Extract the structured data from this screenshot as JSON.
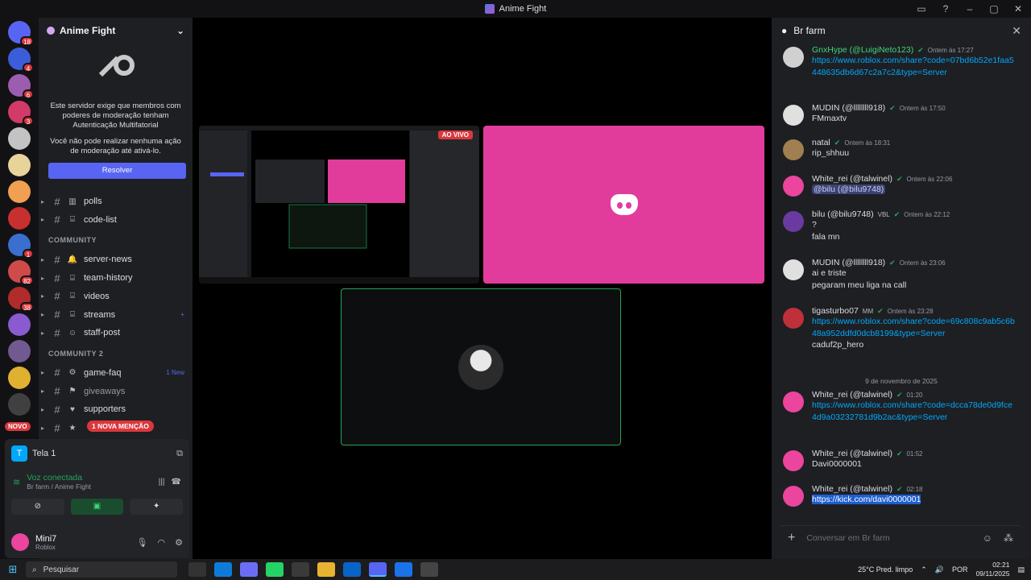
{
  "window": {
    "title": "Anime Fight"
  },
  "rail": {
    "servers": [
      {
        "color": "#5865f2",
        "badge": "18"
      },
      {
        "color": "#3b5dd9",
        "badge": "4"
      },
      {
        "color": "#9b5db0",
        "badge": "6"
      },
      {
        "color": "#d23a6a",
        "badge": "3"
      },
      {
        "color": "#c3c3c3",
        "badge": ""
      },
      {
        "color": "#e8d39a",
        "badge": ""
      },
      {
        "color": "#f0a050",
        "badge": ""
      },
      {
        "color": "#c83030",
        "badge": ""
      },
      {
        "color": "#3a6fd0",
        "badge": "1"
      },
      {
        "color": "#d04a4a",
        "badge": "82"
      },
      {
        "color": "#b02b2b",
        "badge": "38"
      },
      {
        "color": "#8a5ad0",
        "badge": ""
      },
      {
        "color": "#705a90",
        "badge": ""
      },
      {
        "color": "#e0b030",
        "badge": ""
      },
      {
        "color": "#404040",
        "badge": ""
      }
    ],
    "novo_label": "NOVO"
  },
  "server": {
    "name": "Anime Fight",
    "mfa_text": "Este servidor exige que membros com poderes de moderação tenham Autenticação Multifatorial",
    "mfa_sub": "Você não pode realizar nenhuma ação de moderação até ativá-lo.",
    "resolve_label": "Resolver"
  },
  "channels": [
    {
      "name": "polls",
      "icon": "▥",
      "dim": false,
      "extra": ""
    },
    {
      "name": "code-list",
      "icon": "⌸",
      "dim": false,
      "extra": ""
    },
    {
      "category": "COMMUNITY"
    },
    {
      "name": "server-news",
      "icon": "🔔",
      "dim": false,
      "extra": ""
    },
    {
      "name": "team-history",
      "icon": "⌸",
      "dim": false,
      "extra": ""
    },
    {
      "name": "videos",
      "icon": "⌸",
      "dim": false,
      "extra": ""
    },
    {
      "name": "streams",
      "icon": "⌸",
      "dim": false,
      "extra": "+"
    },
    {
      "name": "staff-post",
      "icon": "☺",
      "dim": false,
      "extra": ""
    },
    {
      "category": "COMMUNITY 2"
    },
    {
      "name": "game-faq",
      "icon": "⚙",
      "dim": false,
      "extra": "1 New"
    },
    {
      "name": "giveaways",
      "icon": "⚑",
      "dim": true,
      "extra": ""
    },
    {
      "name": "supporters",
      "icon": "♥",
      "dim": false,
      "extra": ""
    },
    {
      "name": "",
      "icon": "★",
      "dim": false,
      "extra": ""
    }
  ],
  "mention_pill": "1 NOVA MENÇÃO",
  "panel": {
    "screen_label": "Tela 1",
    "voice_status": "Voz conectada",
    "voice_location": "Br farm / Anime Fight",
    "user_name": "Mini7",
    "user_status": "Roblox"
  },
  "stage": {
    "live_label": "AO VIVO"
  },
  "chat": {
    "title": "Br farm",
    "composer_placeholder": "Conversar em Br farm",
    "date_divider": "9 de novembro de 2025",
    "messages": [
      {
        "name": "GnxHype (@LuigiNeto123)",
        "green": true,
        "time": "Ontem às 17:27",
        "lines": [
          "https://www.roblox.com/share?code=07bd6b52e1faa5448635db6d67c2a7c2&type=Server"
        ],
        "link": true,
        "color": "#d0d0d0"
      },
      {
        "name": "MUDIN (@llllllll918)",
        "green": false,
        "time": "Ontem às 17:50",
        "lines": [
          "FMmaxtv"
        ],
        "link": false,
        "color": "#e0e0e0"
      },
      {
        "name": "natal",
        "green": false,
        "time": "Ontem às 18:31",
        "lines": [
          "rip_shhuu"
        ],
        "link": false,
        "color": "#a08050"
      },
      {
        "name": "White_rei (@talwinel)",
        "green": false,
        "time": "Ontem às 22:06",
        "lines": [
          "@bilu (@bilu9748)"
        ],
        "link": false,
        "mention": true,
        "color": "#eb459e"
      },
      {
        "name": "bilu (@bilu9748)",
        "green": false,
        "time": "Ontem às 22:12",
        "tag": "VBL",
        "lines": [
          "?",
          "fala mn"
        ],
        "link": false,
        "color": "#6a3aa0"
      },
      {
        "name": "MUDIN (@llllllll918)",
        "green": false,
        "time": "Ontem às 23:06",
        "lines": [
          "ai e triste",
          "pegaram meu liga na call"
        ],
        "link": false,
        "color": "#e0e0e0"
      },
      {
        "name": "tigasturbo07",
        "green": false,
        "time": "Ontem às 23:28",
        "tag": "MM",
        "lines": [
          "https://www.roblox.com/share?code=69c808c9ab5c6b48a952ddfd0dcb8199&type=Server",
          "caduf2p_hero"
        ],
        "link": true,
        "color": "#c0303a"
      },
      {
        "name": "White_rei (@talwinel)",
        "green": false,
        "time": "01:20",
        "lines": [
          "https://www.roblox.com/share?code=dcca78de0d9fce4d9a03232781d9b2ac&type=Server"
        ],
        "link": true,
        "color": "#eb459e"
      },
      {
        "name": "White_rei (@talwinel)",
        "green": false,
        "time": "01:52",
        "lines": [
          "Davi0000001"
        ],
        "link": false,
        "color": "#eb459e"
      },
      {
        "name": "White_rei (@talwinel)",
        "green": false,
        "time": "02:18",
        "lines": [
          "https://kick.com/davi0000001"
        ],
        "link": true,
        "selected": true,
        "color": "#eb459e"
      }
    ]
  },
  "taskbar": {
    "search_placeholder": "Pesquisar",
    "weather": "25°C  Pred. limpo",
    "lang": "POR",
    "time": "02:21",
    "date": "09/11/2025"
  }
}
